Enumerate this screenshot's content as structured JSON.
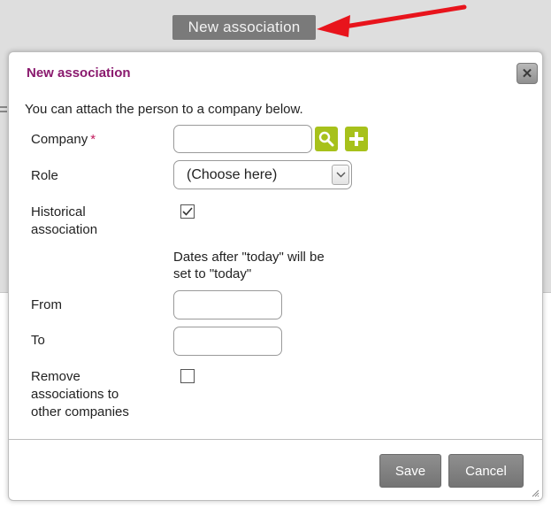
{
  "background": {
    "callout_label": "New association"
  },
  "dialog": {
    "title": "New association",
    "close_icon": "close-icon",
    "intro": "You can attach the person to a company below.",
    "company": {
      "label": "Company",
      "required_marker": "*",
      "value": "",
      "search_icon": "search-icon",
      "add_icon": "plus-icon"
    },
    "role": {
      "label": "Role",
      "selected": "(Choose here)"
    },
    "historical": {
      "label_line1": "Historical",
      "label_line2": "association",
      "checked": true
    },
    "date_note_line1": "Dates after \"today\" will be",
    "date_note_line2": "set to \"today\"",
    "from": {
      "label": "From",
      "value": ""
    },
    "to": {
      "label": "To",
      "value": ""
    },
    "remove": {
      "label_line1": "Remove",
      "label_line2": "associations to",
      "label_line3": "other companies",
      "checked": false
    },
    "save_label": "Save",
    "cancel_label": "Cancel"
  },
  "colors": {
    "title": "#8a1a6e",
    "accent_green": "#a7c11b",
    "button_gray": "#7f7f7f",
    "arrow_red": "#e8141c"
  }
}
